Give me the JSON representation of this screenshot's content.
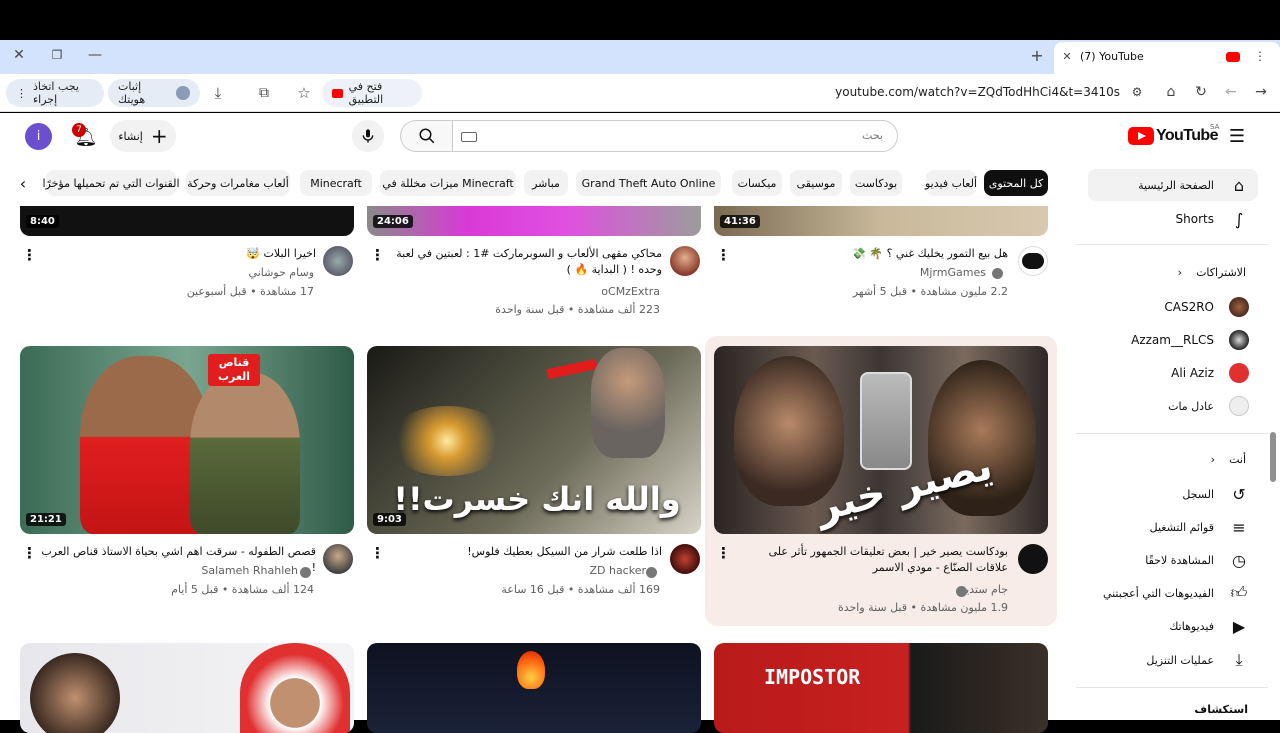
{
  "browser": {
    "tab_title": "(7) YouTube",
    "url": "youtube.com/watch?v=ZQdTodHhCi4&t=3410s",
    "open_in_app": "فتح في التطبيق",
    "verify_identity": "إثبات هويتك",
    "action_needed": "يجب اتخاذ إجراء"
  },
  "header": {
    "logo_text": "YouTube",
    "logo_region": "SA",
    "search_placeholder": "بحث",
    "create_label": "إنشاء",
    "notifications_count": "7",
    "avatar_letter": "i"
  },
  "chips": [
    "كل المحتوى",
    "ألعاب فيديو",
    "بودكاست",
    "موسيقى",
    "ميكسات",
    "Grand Theft Auto Online",
    "مباشر",
    "ميزات مخللة في Minecraft",
    "Minecraft",
    "ألعاب مغامرات وحركة",
    "القنوات التي تم تحميلها مؤخرًا"
  ],
  "sidebar": {
    "home": "الصفحة الرئيسية",
    "shorts": "Shorts",
    "subscriptions_header": "الاشتراكات",
    "subscriptions": [
      "CAS2RO",
      "Azzam__RLCS",
      "Ali Aziz",
      "عادل مات"
    ],
    "you_header": "أنت",
    "you_items": [
      "السجل",
      "قوائم التشغيل",
      "المشاهدة لاحقًا",
      "الفيديوهات التي أعجبتني",
      "فيديوهاتك",
      "عمليات التنزيل"
    ],
    "explore_header": "استكشاف"
  },
  "videos_row1": [
    {
      "duration": "41:36",
      "title": "هل بيع التمور يخليك غني ؟ 🌴 💸",
      "channel": "MjrmGames",
      "verified": true,
      "meta": "2.2 مليون مشاهدة • قبل 5 أشهر"
    },
    {
      "duration": "24:06",
      "title": "محاكي مقهى الألعاب و السوبرماركت #1 : لعبتين في لعبة وحده ! ( البداية 🔥 )",
      "channel": "oCMzExtra",
      "verified": false,
      "meta": "223 ألف مشاهدة • قبل سنة واحدة"
    },
    {
      "duration": "8:40",
      "title": "اخيرا البلات 🤯",
      "channel": "وسام حوشاني",
      "verified": false,
      "meta": "17 مشاهدة • قبل أسبوعين"
    }
  ],
  "videos_row2": [
    {
      "duration": "",
      "overlay_text": "يصير خير",
      "title": "بودكاست يصير خير | بعض تعليقات الجمهور تأثر على علاقات الصنّاع - مودي الاسمر",
      "channel": "جام ستديو",
      "verified": true,
      "meta": "1.9 مليون مشاهدة • قبل سنة واحدة"
    },
    {
      "duration": "9:03",
      "overlay_text": "والله انك خسرت!!",
      "title": "اذا طلعت شرار من السيكل بعطيك فلوس!",
      "channel": "ZD hacker",
      "verified": true,
      "meta": "169 ألف مشاهدة • قبل 16 ساعة"
    },
    {
      "duration": "21:21",
      "overlay_text": "قناص العرب",
      "title": "قصص الطفوله - سرقت اهم اشي بحياة الاستاذ قناص العرب !",
      "channel": "Salameh Rhahleh",
      "verified": true,
      "meta": "124 ألف مشاهدة • قبل 5 أيام"
    }
  ],
  "row3_overlay": "IMPOSTOR",
  "colors": {
    "accent_red": "#ff0000",
    "avatar_purple": "#6a4fcf"
  }
}
